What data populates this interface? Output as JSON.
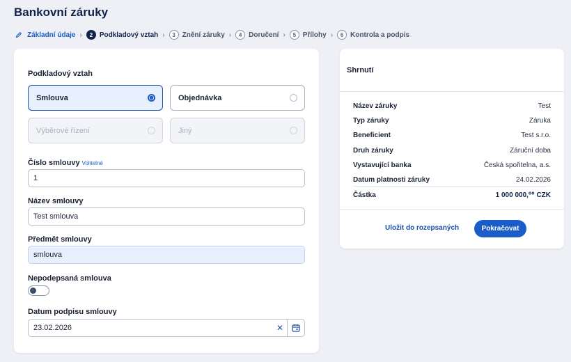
{
  "page": {
    "title": "Bankovní záruky"
  },
  "stepper": {
    "steps": [
      {
        "number": "",
        "label": "Základní údaje",
        "state": "done"
      },
      {
        "number": "2",
        "label": "Podkladový vztah",
        "state": "active"
      },
      {
        "number": "3",
        "label": "Znění záruky",
        "state": "pending"
      },
      {
        "number": "4",
        "label": "Doručení",
        "state": "pending"
      },
      {
        "number": "5",
        "label": "Přílohy",
        "state": "pending"
      },
      {
        "number": "6",
        "label": "Kontrola a podpis",
        "state": "pending"
      }
    ]
  },
  "form": {
    "relation_label": "Podkladový vztah",
    "options": [
      {
        "label": "Smlouva",
        "state": "selected"
      },
      {
        "label": "Objednávka",
        "state": "enabled"
      },
      {
        "label": "Výběrové řízení",
        "state": "disabled"
      },
      {
        "label": "Jiný",
        "state": "disabled"
      }
    ],
    "contract_number": {
      "label": "Číslo smlouvy",
      "optional": "Volitelné",
      "value": "1"
    },
    "contract_name": {
      "label": "Název smlouvy",
      "value": "Test smlouva"
    },
    "contract_subject": {
      "label": "Předmět smlouvy",
      "value": "smlouva"
    },
    "unsigned": {
      "label": "Nepodepsaná smlouva",
      "checked": false
    },
    "sign_date": {
      "label": "Datum podpisu smlouvy",
      "value": "23.02.2026"
    }
  },
  "summary": {
    "title": "Shrnutí",
    "rows": [
      {
        "key": "Název záruky",
        "value": "Test"
      },
      {
        "key": "Typ záruky",
        "value": "Záruka"
      },
      {
        "key": "Beneficient",
        "value": "Test s.r.o."
      },
      {
        "key": "Druh záruky",
        "value": "Záruční doba"
      },
      {
        "key": "Vystavující banka",
        "value": "Česká spořitelna, a.s."
      },
      {
        "key": "Datum platnosti záruky",
        "value": "24.02.2026"
      }
    ],
    "total": {
      "key": "Částka",
      "value": "1 000 000,⁰⁰ CZK"
    },
    "save_label": "Uložit do rozepsaných",
    "continue_label": "Pokračovat"
  },
  "colors": {
    "accent": "#1a5cc8",
    "title": "#10234a",
    "background": "#eef0f5"
  }
}
